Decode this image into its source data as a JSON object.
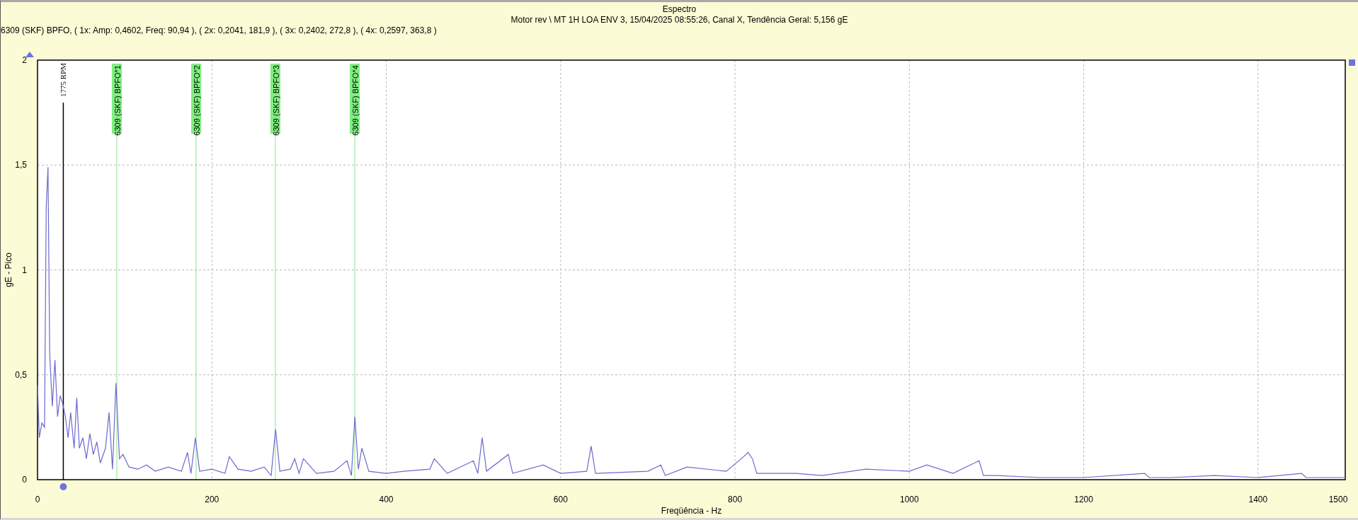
{
  "title": "Espectro",
  "subtitle": "Motor rev \\ MT 1H LOA ENV 3, 15/04/2025 08:55:26, Canal X, Tendência Geral: 5,156 gE",
  "bearing_line": "6309 (SKF) BPFO, ( 1x: Amp: 0,4602, Freq: 90,94 ), ( 2x: 0,2041, 181,9 ), ( 3x: 0,2402, 272,8 ), ( 4x: 0,2597, 363,8 )",
  "chart_data": {
    "type": "line",
    "xlabel": "Freqüência - Hz",
    "ylabel": "gE - Pico",
    "xlim": [
      0,
      1500
    ],
    "ylim": [
      0,
      2
    ],
    "xticks": [
      0,
      200,
      400,
      600,
      800,
      1000,
      1200,
      1400,
      1500
    ],
    "yticks": [
      0,
      {
        "value": 0.5,
        "label": "0,5"
      },
      1,
      {
        "value": 1.5,
        "label": "1,5"
      },
      2
    ],
    "x": [
      0,
      2,
      5,
      8,
      10,
      12,
      14,
      17,
      20,
      23,
      26,
      29,
      32,
      35,
      38,
      42,
      45,
      48,
      52,
      56,
      60,
      64,
      68,
      72,
      78,
      82,
      86,
      90,
      94,
      98,
      105,
      115,
      125,
      135,
      150,
      165,
      172,
      176,
      181,
      186,
      200,
      215,
      220,
      230,
      245,
      260,
      268,
      273,
      278,
      290,
      295,
      300,
      305,
      320,
      340,
      355,
      360,
      364,
      368,
      372,
      380,
      400,
      420,
      450,
      455,
      470,
      500,
      505,
      510,
      515,
      540,
      545,
      580,
      600,
      630,
      635,
      640,
      700,
      715,
      720,
      745,
      790,
      810,
      815,
      820,
      825,
      870,
      900,
      950,
      1000,
      1020,
      1050,
      1080,
      1085,
      1100,
      1150,
      1200,
      1270,
      1275,
      1300,
      1350,
      1400,
      1450,
      1455,
      1500
    ],
    "grid": true,
    "series": [
      {
        "color": "#6a6ad0",
        "values": [
          0.45,
          0.2,
          0.27,
          0.25,
          1.3,
          1.49,
          0.6,
          0.35,
          0.57,
          0.3,
          0.4,
          0.36,
          0.3,
          0.2,
          0.32,
          0.15,
          0.39,
          0.15,
          0.2,
          0.1,
          0.22,
          0.12,
          0.18,
          0.08,
          0.15,
          0.32,
          0.05,
          0.46,
          0.1,
          0.12,
          0.06,
          0.05,
          0.07,
          0.04,
          0.06,
          0.04,
          0.13,
          0.03,
          0.2,
          0.04,
          0.05,
          0.03,
          0.11,
          0.05,
          0.04,
          0.06,
          0.02,
          0.24,
          0.04,
          0.05,
          0.1,
          0.03,
          0.1,
          0.03,
          0.04,
          0.09,
          0.02,
          0.3,
          0.05,
          0.15,
          0.04,
          0.03,
          0.04,
          0.05,
          0.1,
          0.03,
          0.09,
          0.03,
          0.2,
          0.04,
          0.12,
          0.03,
          0.07,
          0.03,
          0.04,
          0.16,
          0.03,
          0.04,
          0.07,
          0.02,
          0.06,
          0.04,
          0.11,
          0.13,
          0.1,
          0.03,
          0.03,
          0.02,
          0.05,
          0.04,
          0.07,
          0.03,
          0.09,
          0.02,
          0.02,
          0.01,
          0.01,
          0.03,
          0.01,
          0.01,
          0.02,
          0.01,
          0.03,
          0.01,
          0.01
        ]
      }
    ],
    "ref_lines": [
      {
        "axis": "x",
        "value": 29.58,
        "label": "1775 RPM",
        "color": "#000000"
      }
    ],
    "annotations": [
      {
        "x": 90.94,
        "text": "6309 (SKF) BPFO*1"
      },
      {
        "x": 181.9,
        "text": "6309 (SKF) BPFO*2"
      },
      {
        "x": 272.8,
        "text": "6309 (SKF) BPFO*3"
      },
      {
        "x": 363.8,
        "text": "6309 (SKF) BPFO*4"
      }
    ]
  }
}
